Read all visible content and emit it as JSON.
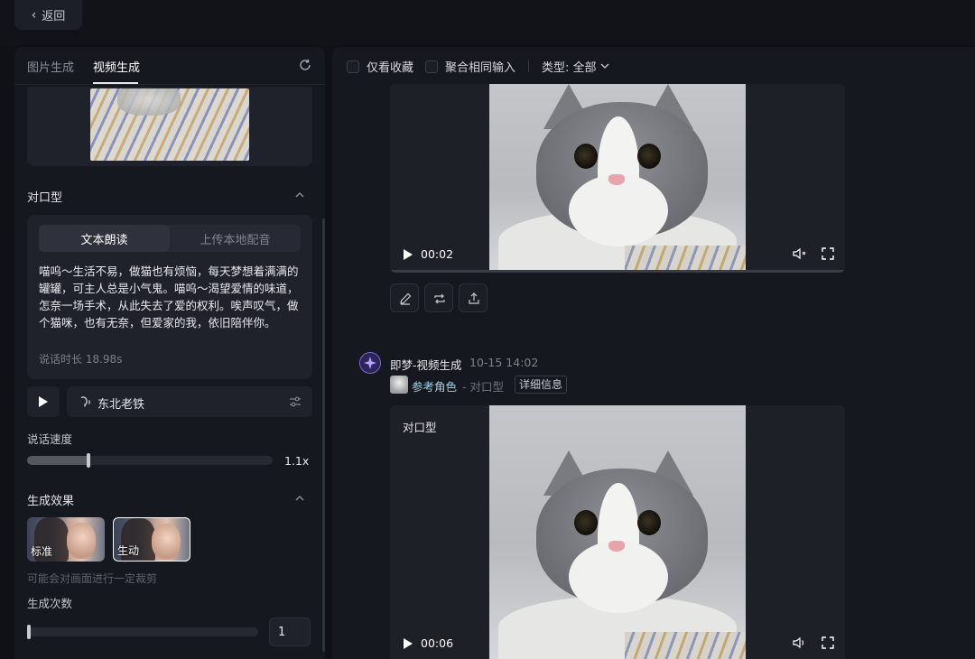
{
  "header": {
    "back_label": "返回"
  },
  "left_panel": {
    "tabs": [
      {
        "label": "图片生成"
      },
      {
        "label": "视频生成"
      }
    ],
    "lipsync": {
      "title": "对口型",
      "mode_tabs": [
        "文本朗读",
        "上传本地配音"
      ],
      "text": "喵呜～生活不易，做猫也有烦恼，每天梦想着满满的罐罐，可主人总是小气鬼。喵呜～渴望爱情的味道，怎奈一场手术，从此失去了爱的权利。唉声叹气，做个猫咪，也有无奈，但爱家的我，依旧陪伴你。",
      "duration": "说话时长 18.98s",
      "voice": "东北老铁",
      "speed_label": "说话速度",
      "speed_value": "1.1x",
      "speed_fraction": 0.25
    },
    "effect": {
      "title": "生成效果",
      "options": [
        {
          "label": "标准",
          "selected": false
        },
        {
          "label": "生动",
          "selected": true
        }
      ],
      "hint": "可能会对画面进行一定裁剪"
    },
    "count": {
      "label": "生成次数",
      "value": "1",
      "fraction": 0
    }
  },
  "right_panel": {
    "filters": {
      "favorites": "仅看收藏",
      "merge": "聚合相同输入",
      "type": "类型: 全部"
    },
    "video1": {
      "time": "00:02"
    },
    "message": {
      "author": "即梦-视频生成",
      "timestamp": "10-15   14:02",
      "ref_label": "参考角色",
      "ref_mode": "- 对口型",
      "detail": "详细信息"
    },
    "video2": {
      "tag": "对口型",
      "time": "00:06"
    }
  },
  "colors": {
    "background": "#0f1116",
    "panel": "#16181f",
    "card": "#1f222b",
    "accent": "#7c67d6"
  }
}
